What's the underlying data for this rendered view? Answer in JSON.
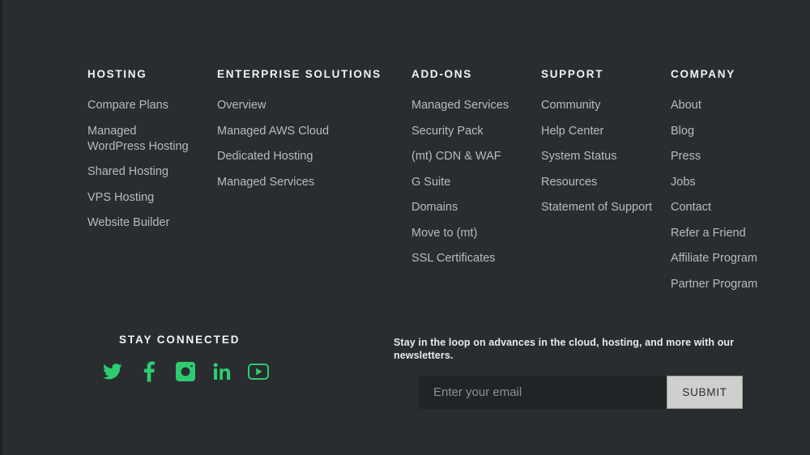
{
  "theme": {
    "background": "#292d30",
    "accent_green": "#2ecc71",
    "heading_color": "#f2f3f4",
    "link_color": "#b9bbbd",
    "input_background": "#212426",
    "submit_background": "#cfcfce"
  },
  "nav_columns": [
    {
      "title": "HOSTING",
      "links": [
        "Compare Plans",
        "Managed WordPress Hosting",
        "Shared Hosting",
        "VPS Hosting",
        "Website Builder"
      ]
    },
    {
      "title": "ENTERPRISE SOLUTIONS",
      "links": [
        "Overview",
        "Managed AWS Cloud",
        "Dedicated Hosting",
        "Managed Services"
      ]
    },
    {
      "title": "ADD-ONS",
      "links": [
        "Managed Services",
        "Security Pack",
        "(mt) CDN & WAF",
        "G Suite",
        "Domains",
        "Move to (mt)",
        "SSL Certificates"
      ]
    },
    {
      "title": "SUPPORT",
      "links": [
        "Community",
        "Help Center",
        "System Status",
        "Resources",
        "Statement of Support"
      ]
    },
    {
      "title": "COMPANY",
      "links": [
        "About",
        "Blog",
        "Press",
        "Jobs",
        "Contact",
        "Refer a Friend",
        "Affiliate Program",
        "Partner Program"
      ]
    }
  ],
  "connect": {
    "title": "STAY CONNECTED",
    "socials": [
      {
        "name": "twitter",
        "icon": "twitter-icon"
      },
      {
        "name": "facebook",
        "icon": "facebook-icon"
      },
      {
        "name": "instagram",
        "icon": "instagram-icon"
      },
      {
        "name": "linkedin",
        "icon": "linkedin-icon"
      },
      {
        "name": "youtube",
        "icon": "youtube-icon"
      }
    ]
  },
  "newsletter": {
    "text": "Stay in the loop on advances in the cloud, hosting, and more with our newsletters.",
    "email_placeholder": "Enter your email",
    "email_value": "",
    "submit_label": "SUBMIT"
  }
}
